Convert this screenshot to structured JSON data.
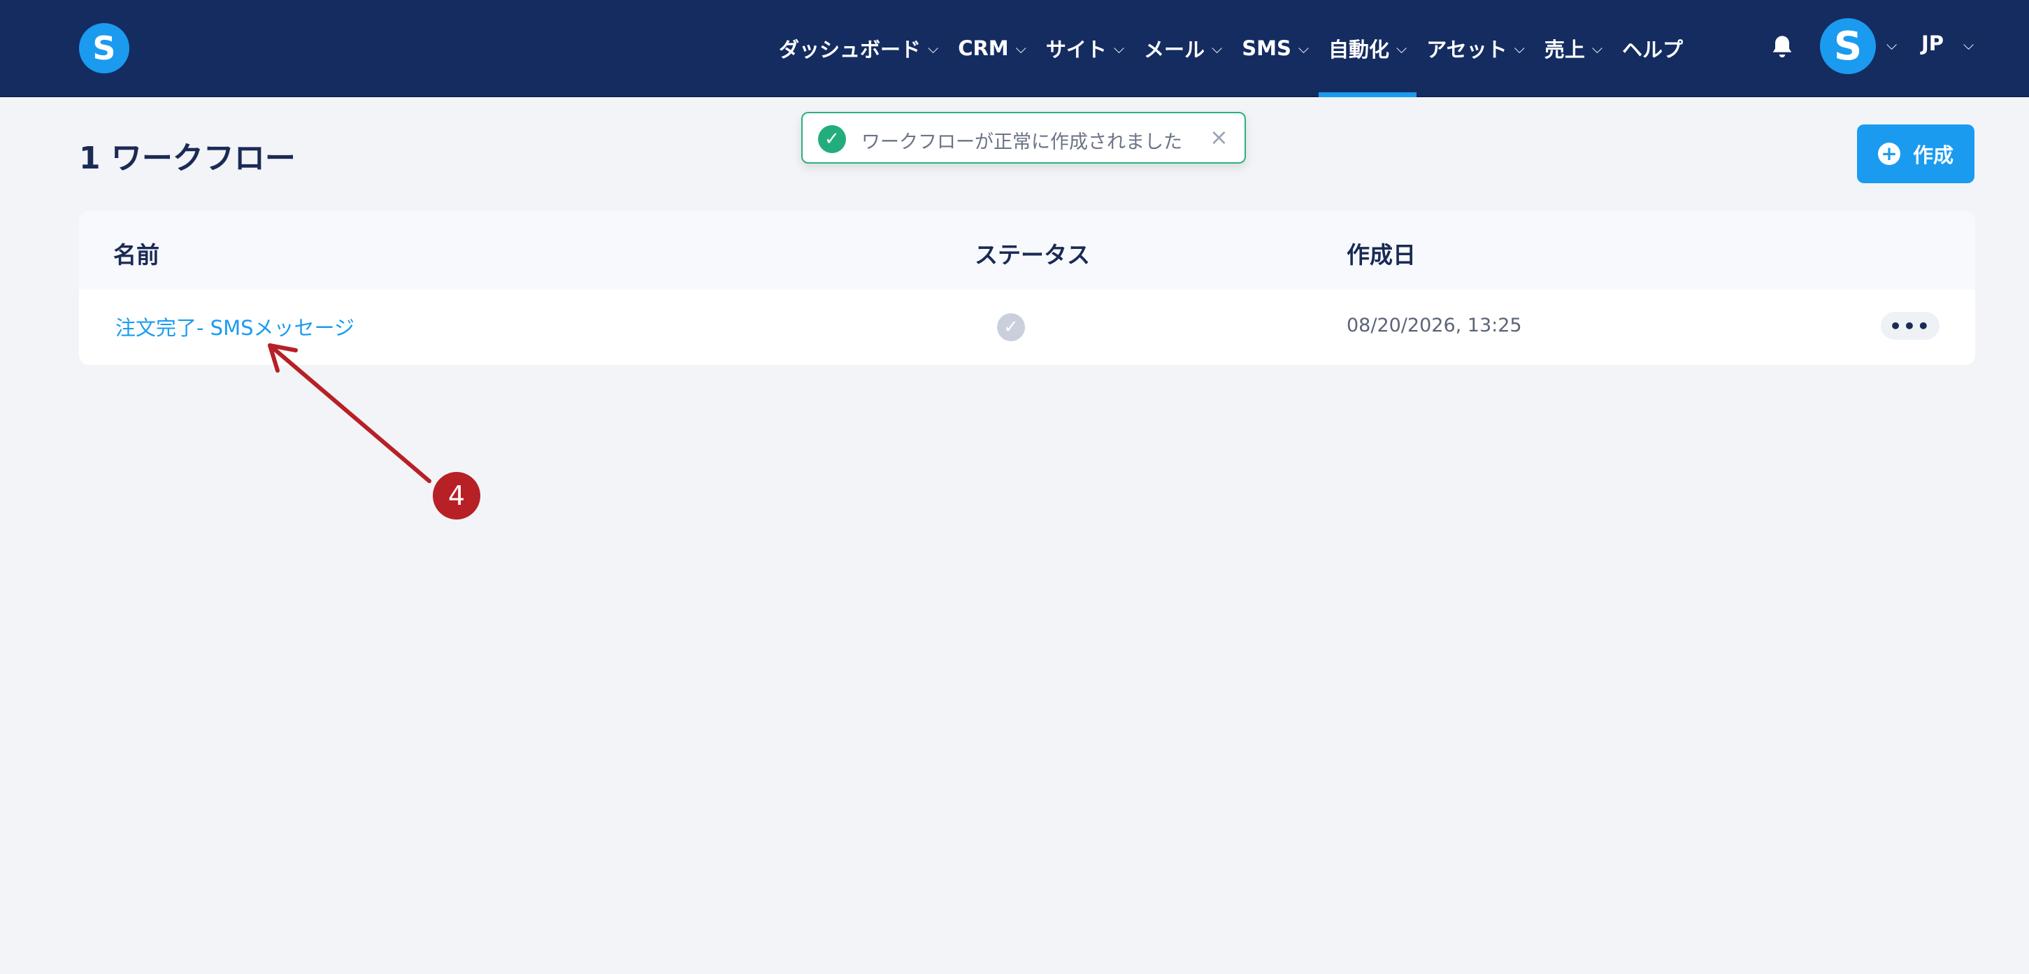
{
  "header": {
    "logo_letter": "S",
    "nav": [
      {
        "label": "ダッシュボード",
        "has_dropdown": true
      },
      {
        "label": "CRM",
        "has_dropdown": true
      },
      {
        "label": "サイト",
        "has_dropdown": true
      },
      {
        "label": "メール",
        "has_dropdown": true
      },
      {
        "label": "SMS",
        "has_dropdown": true
      },
      {
        "label": "自動化",
        "has_dropdown": true,
        "active": true
      },
      {
        "label": "アセット",
        "has_dropdown": true
      },
      {
        "label": "売上",
        "has_dropdown": true
      },
      {
        "label": "ヘルプ",
        "has_dropdown": false
      }
    ],
    "notification_icon": "bell-icon",
    "avatar_letter": "S",
    "language": "JP"
  },
  "page": {
    "title": "1 ワークフロー",
    "create_label": "作成"
  },
  "toast": {
    "message": "ワークフローが正常に作成されました",
    "icon": "check-circle-icon"
  },
  "table": {
    "columns": [
      "名前",
      "ステータス",
      "作成日"
    ],
    "rows": [
      {
        "name": "注文完了- SMSメッセージ",
        "status_icon": "check-circle-icon",
        "created": "08/20/2026, 13:25",
        "actions_label": "•••"
      }
    ]
  },
  "annotation": {
    "step_number": "4"
  },
  "colors": {
    "header_bg": "#152c61",
    "accent": "#1a9bf0",
    "success": "#23ad7d",
    "annotation": "#b72025"
  }
}
